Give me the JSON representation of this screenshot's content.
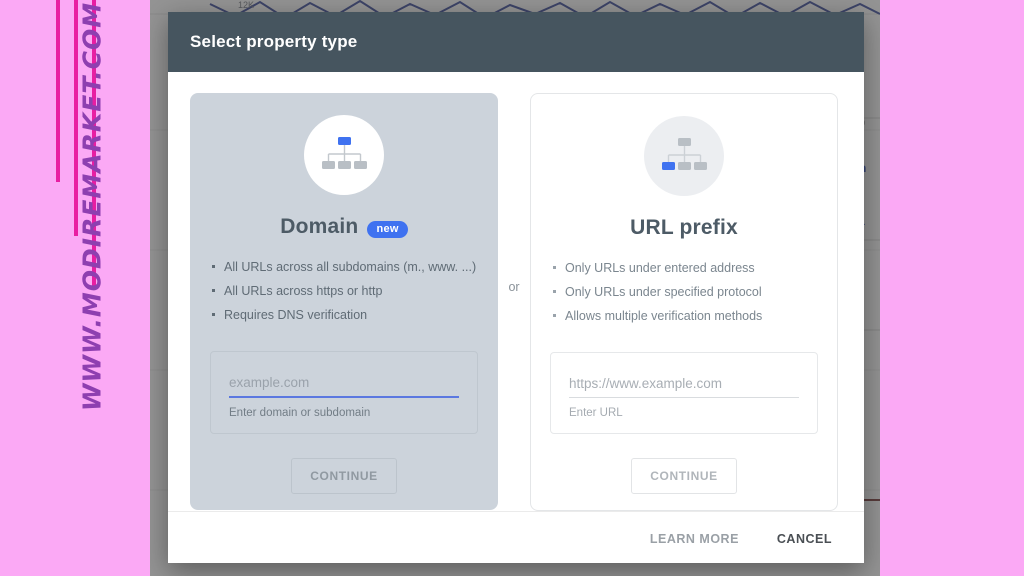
{
  "watermark": {
    "text": "WWW.MODIREMARKET.COM"
  },
  "background": {
    "axis_label": "12K"
  },
  "modal": {
    "title": "Select property type",
    "or_label": "or",
    "cards": [
      {
        "id": "domain",
        "icon_name": "sitemap-icon",
        "title": "Domain",
        "badge": "new",
        "bullets": [
          "All URLs across all subdomains (m., www. ...)",
          "All URLs across https or http",
          "Requires DNS verification"
        ],
        "input_placeholder": "example.com",
        "input_value": "",
        "helper": "Enter domain or subdomain",
        "continue_label": "CONTINUE"
      },
      {
        "id": "url_prefix",
        "icon_name": "sitemap-icon",
        "title": "URL prefix",
        "badge": "",
        "bullets": [
          "Only URLs under entered address",
          "Only URLs under specified protocol",
          "Allows multiple verification methods"
        ],
        "input_placeholder": "https://www.example.com",
        "input_value": "",
        "helper": "Enter URL",
        "continue_label": "CONTINUE"
      }
    ],
    "footer": {
      "learn_more_label": "LEARN MORE",
      "cancel_label": "CANCEL"
    }
  },
  "colors": {
    "header_bg": "#46555f",
    "accent_blue": "#3f72f0",
    "domain_card_bg": "#ccd3db",
    "watermark_pink": "#fba9f5",
    "watermark_bar": "#e81ea2",
    "watermark_text": "#8e3fb0"
  }
}
